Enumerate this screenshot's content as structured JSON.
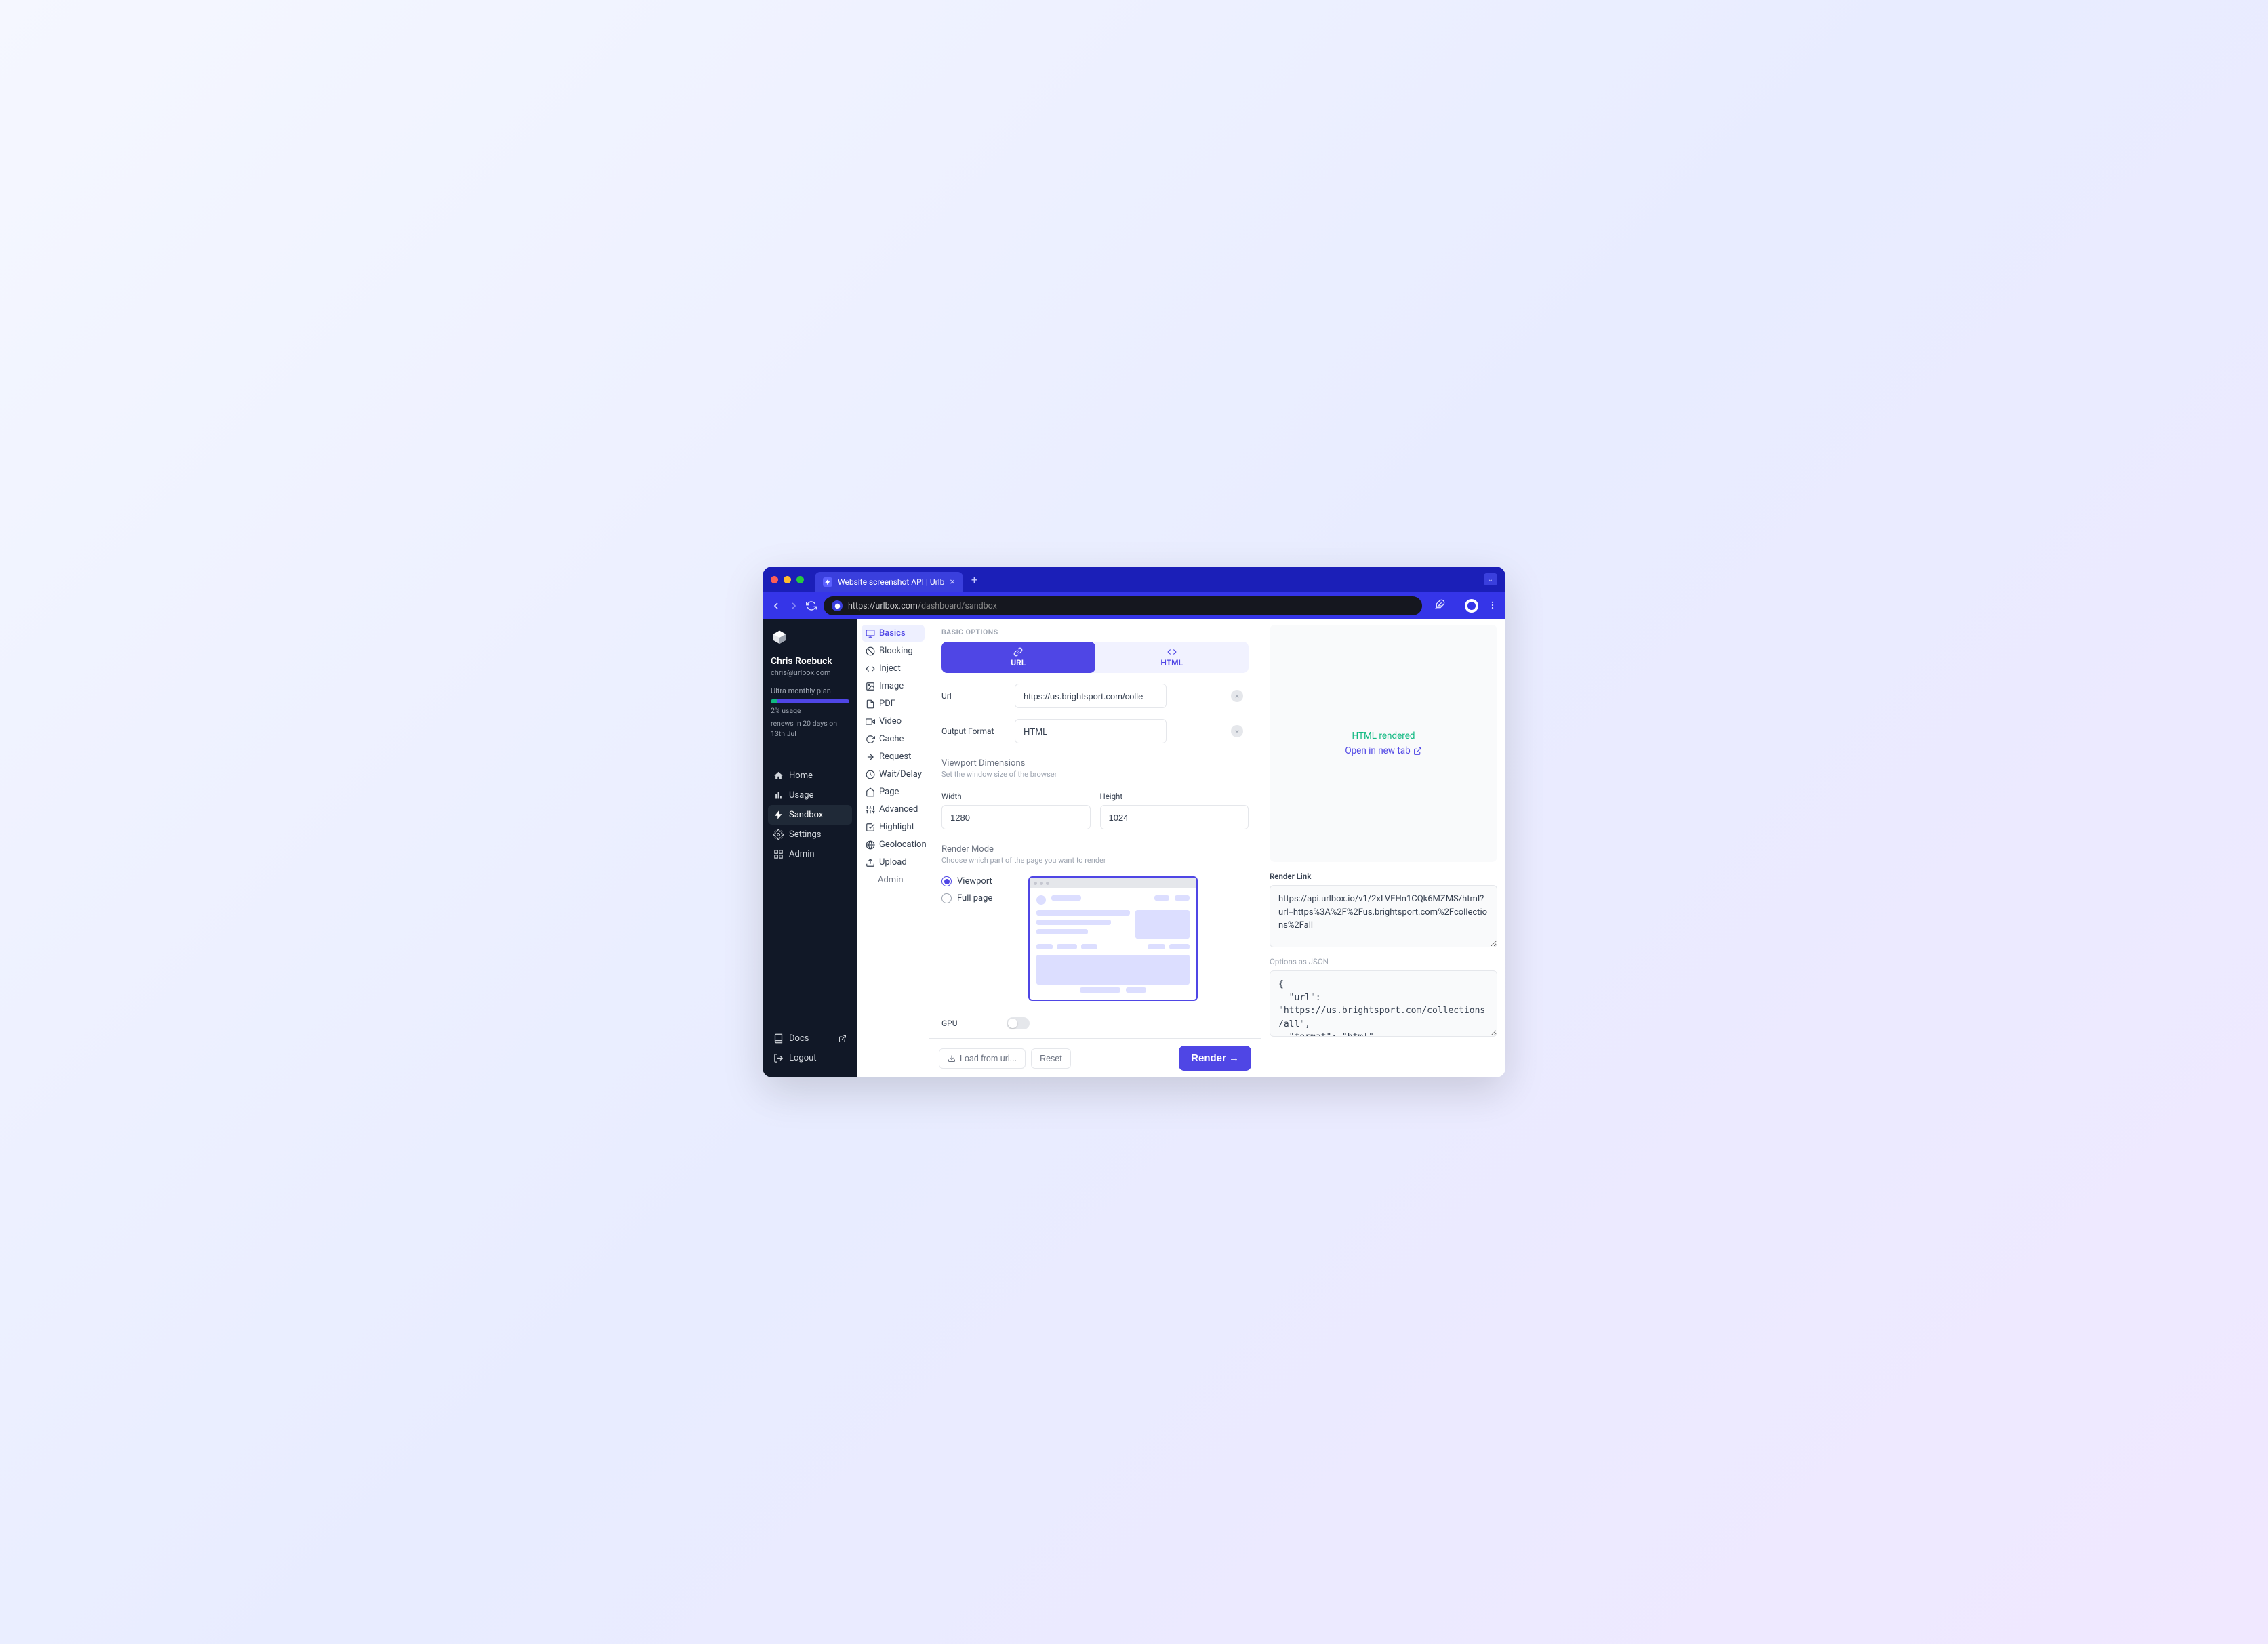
{
  "browser": {
    "tab_title": "Website screenshot API | Urlb",
    "url_host": "https://urlbox.com",
    "url_path": "/dashboard/sandbox"
  },
  "sidebar": {
    "user_name": "Chris Roebuck",
    "user_email": "chris@urlbox.com",
    "plan_name": "Ultra monthly",
    "plan_suffix": "plan",
    "usage_text": "2% usage",
    "renew_text": "renews in 20 days on 13th Jul",
    "nav": {
      "home": "Home",
      "usage": "Usage",
      "sandbox": "Sandbox",
      "settings": "Settings",
      "admin": "Admin",
      "docs": "Docs",
      "logout": "Logout"
    }
  },
  "config_tabs": {
    "basics": "Basics",
    "blocking": "Blocking",
    "inject": "Inject",
    "image": "Image",
    "pdf": "PDF",
    "video": "Video",
    "cache": "Cache",
    "request": "Request",
    "wait_delay": "Wait/Delay",
    "page": "Page",
    "advanced": "Advanced",
    "highlight": "Highlight",
    "geolocation": "Geolocation",
    "upload": "Upload",
    "admin_sub": "Admin"
  },
  "form": {
    "eyebrow": "BASIC OPTIONS",
    "tab_url": "URL",
    "tab_html": "HTML",
    "url_label": "Url",
    "url_value": "https://us.brightsport.com/collections/all",
    "format_label": "Output Format",
    "format_value": "HTML",
    "viewport_title": "Viewport Dimensions",
    "viewport_desc": "Set the window size of the browser",
    "width_label": "Width",
    "width_value": "1280",
    "height_label": "Height",
    "height_value": "1024",
    "render_title": "Render Mode",
    "render_desc": "Choose which part of the page you want to render",
    "radio_viewport": "Viewport",
    "radio_fullpage": "Full page",
    "gpu_label": "GPU"
  },
  "footer": {
    "load_btn": "Load from url...",
    "reset_btn": "Reset",
    "render_btn": "Render →"
  },
  "output": {
    "success_text": "HTML rendered",
    "open_link_text": "Open in new tab",
    "render_link_label": "Render Link",
    "render_link_value": "https://api.urlbox.io/v1/2xLVEHn1CQk6MZMS/html?url=https%3A%2F%2Fus.brightsport.com%2Fcollections%2Fall",
    "options_label": "Options",
    "options_suffix": "as JSON",
    "options_json": "{\n  \"url\": \"https://us.brightsport.com/collections/all\",\n  \"format\": \"html\""
  }
}
